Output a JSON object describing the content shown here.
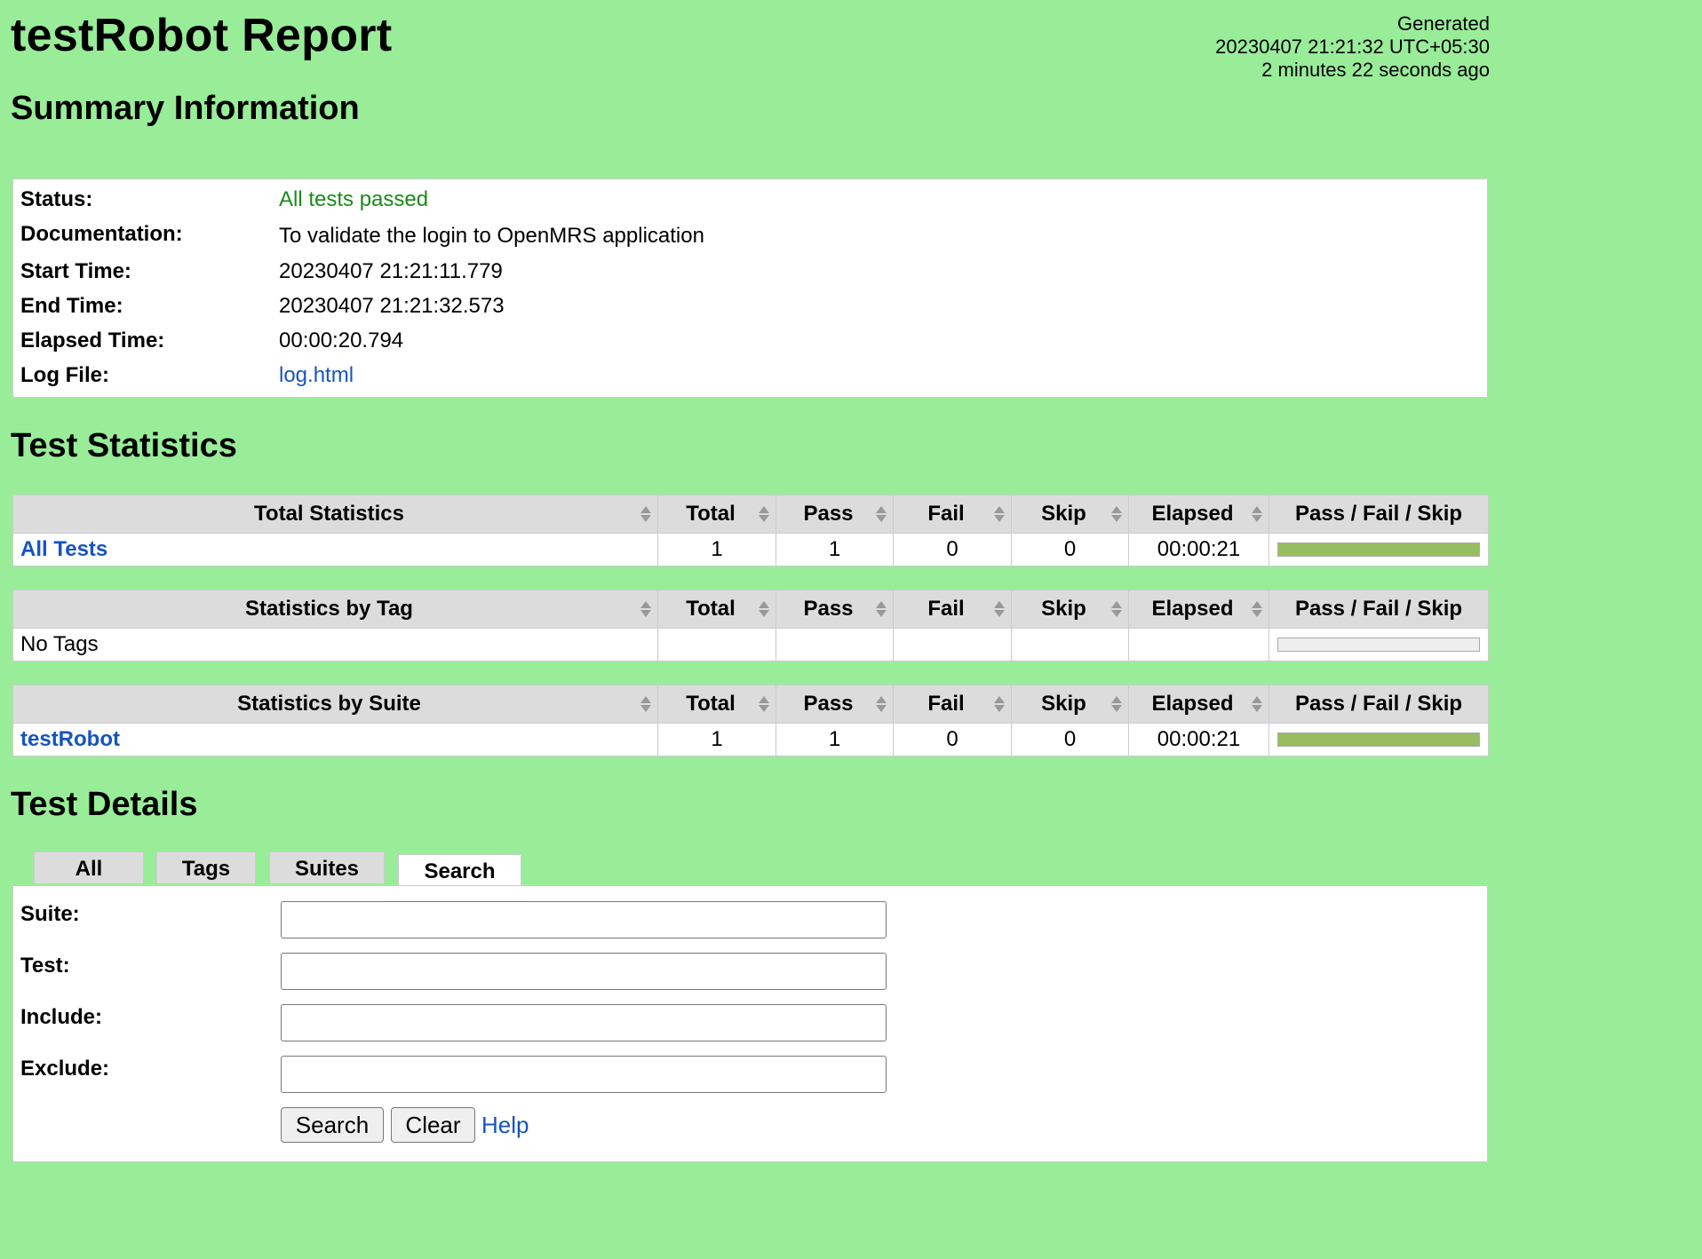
{
  "header": {
    "title": "testRobot Report",
    "generated_label": "Generated",
    "generated_time": "20230407 21:21:32 UTC+05:30",
    "generated_ago": "2 minutes 22 seconds ago"
  },
  "summary": {
    "heading": "Summary Information",
    "rows": [
      {
        "key": "Status:",
        "value": "All tests passed"
      },
      {
        "key": "Documentation:",
        "value": "To validate the login to OpenMRS application"
      },
      {
        "key": "Start Time:",
        "value": "20230407 21:21:11.779"
      },
      {
        "key": "End Time:",
        "value": "20230407 21:21:32.573"
      },
      {
        "key": "Elapsed Time:",
        "value": "00:00:20.794"
      },
      {
        "key": "Log File:",
        "value": "log.html"
      }
    ]
  },
  "statistics": {
    "heading": "Test Statistics",
    "columns": [
      "Total",
      "Pass",
      "Fail",
      "Skip",
      "Elapsed",
      "Pass / Fail / Skip"
    ],
    "total": {
      "header": "Total Statistics",
      "row": {
        "name": "All Tests",
        "total": "1",
        "pass": "1",
        "fail": "0",
        "skip": "0",
        "elapsed": "00:00:21",
        "pass_ratio": 1.0
      }
    },
    "by_tag": {
      "header": "Statistics by Tag",
      "row": {
        "name": "No Tags",
        "total": "",
        "pass": "",
        "fail": "",
        "skip": "",
        "elapsed": "",
        "pass_ratio": 0
      }
    },
    "by_suite": {
      "header": "Statistics by Suite",
      "row": {
        "name": "testRobot",
        "total": "1",
        "pass": "1",
        "fail": "0",
        "skip": "0",
        "elapsed": "00:00:21",
        "pass_ratio": 1.0
      }
    }
  },
  "details": {
    "heading": "Test Details",
    "tabs": [
      "All",
      "Tags",
      "Suites",
      "Search"
    ],
    "active_tab": "Search",
    "form": {
      "suite_label": "Suite:",
      "test_label": "Test:",
      "include_label": "Include:",
      "exclude_label": "Exclude:",
      "suite_value": "",
      "test_value": "",
      "include_value": "",
      "exclude_value": ""
    },
    "search_button": "Search",
    "clear_button": "Clear",
    "help_link": "Help"
  },
  "colors": {
    "background": "#99ed99",
    "pass_bar": "#97bd61",
    "link": "#1654c0",
    "pass_text": "#1a8a1a"
  }
}
